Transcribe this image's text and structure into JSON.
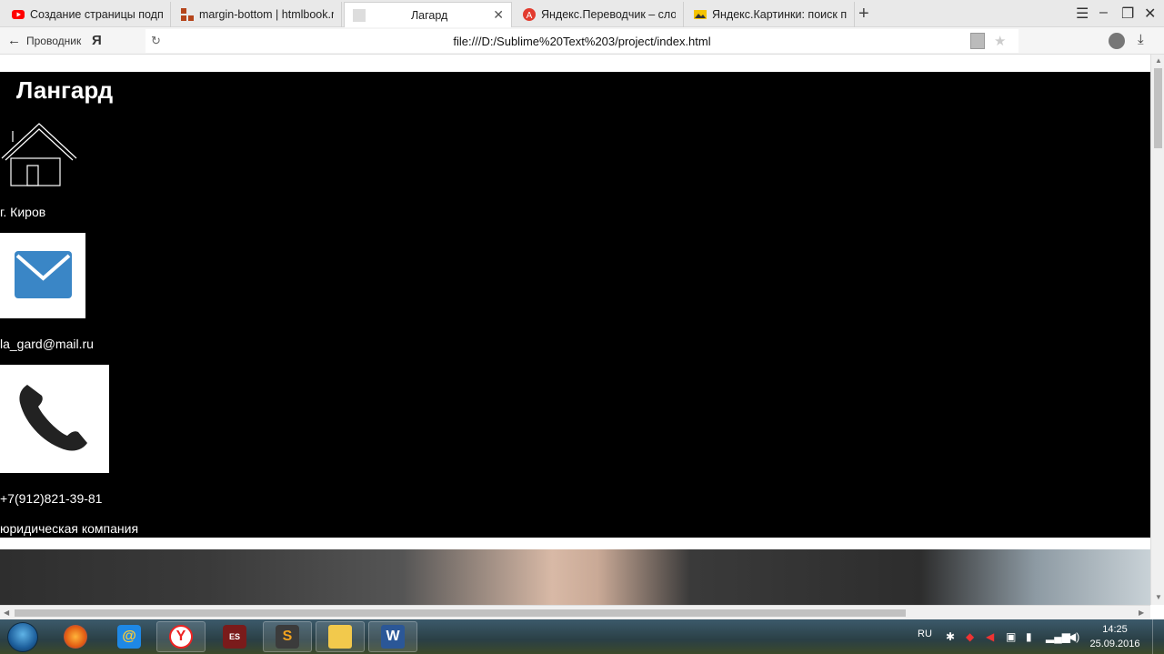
{
  "browser": {
    "tabs": [
      {
        "label": "Создание страницы подпис",
        "icon": "youtube-icon",
        "color": "#ff0000"
      },
      {
        "label": "margin-bottom | htmlbook.r",
        "icon": "htmlbook-icon",
        "color": "#b5451b"
      },
      {
        "label": "Лагард",
        "icon": "blank-page-icon",
        "active": true
      },
      {
        "label": "Яндекс.Переводчик – слова",
        "icon": "translator-icon",
        "color": "#e23b2e"
      },
      {
        "label": "Яндекс.Картинки: поиск по",
        "icon": "images-icon",
        "color": "#f5c400"
      }
    ],
    "new_tab_glyph": "+",
    "address": {
      "back_label": "Проводник",
      "url": "file:///D:/Sublime%20Text%203/project/index.html"
    }
  },
  "page": {
    "title": "Лангард",
    "city": "г. Киров",
    "email": "la_gard@mail.ru",
    "phone": "+7(912)821-39-81",
    "company": "юридическая компания",
    "mail_icon_color": "#3a86c6"
  },
  "taskbar": {
    "apps": [
      "firefox-icon",
      "mail-ru-agent-icon",
      "yandex-browser-icon",
      "game-icon",
      "sublime-text-icon",
      "file-explorer-icon",
      "word-icon"
    ],
    "language": "RU",
    "time": "14:25",
    "date": "25.09.2016"
  }
}
